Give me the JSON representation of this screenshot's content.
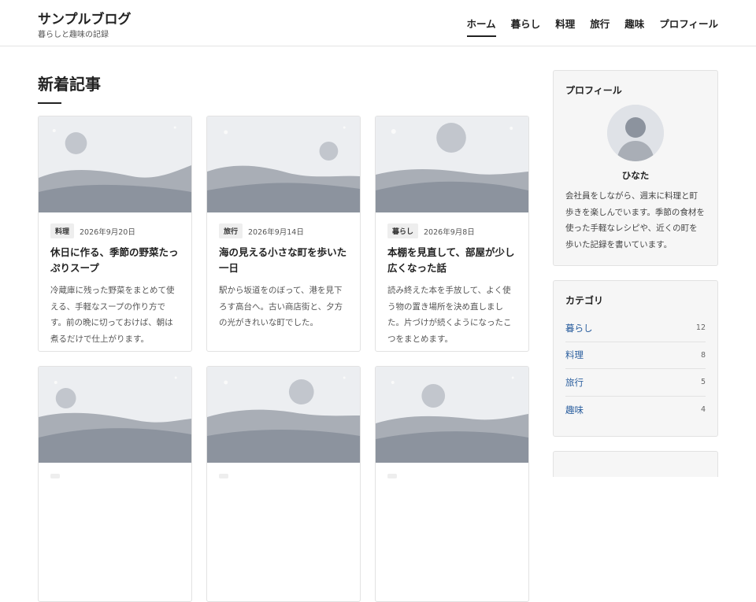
{
  "header": {
    "site_title": "サンプルブログ",
    "tagline": "暮らしと趣味の記録",
    "nav": [
      {
        "label": "ホーム",
        "active": true
      },
      {
        "label": "暮らし"
      },
      {
        "label": "料理"
      },
      {
        "label": "旅行"
      },
      {
        "label": "趣味"
      },
      {
        "label": "プロフィール"
      }
    ]
  },
  "main": {
    "section_title": "新着記事",
    "posts": [
      {
        "category": "料理",
        "date": "2026年9月20日",
        "title": "休日に作る、季節の野菜たっぷりスープ",
        "excerpt": "冷蔵庫に残った野菜をまとめて使える、手軽なスープの作り方です。前の晩に切っておけば、朝は煮るだけで仕上がります。"
      },
      {
        "category": "旅行",
        "date": "2026年9月14日",
        "title": "海の見える小さな町を歩いた一日",
        "excerpt": "駅から坂道をのぼって、港を見下ろす高台へ。古い商店街と、夕方の光がきれいな町でした。"
      },
      {
        "category": "暮らし",
        "date": "2026年9月8日",
        "title": "本棚を見直して、部屋が少し広くなった話",
        "excerpt": "読み終えた本を手放して、よく使う物の置き場所を決め直しました。片づけが続くようになったこつをまとめます。"
      },
      {
        "category": "",
        "date": "",
        "title": "",
        "excerpt": ""
      },
      {
        "category": "",
        "date": "",
        "title": "",
        "excerpt": ""
      },
      {
        "category": "",
        "date": "",
        "title": "",
        "excerpt": ""
      }
    ]
  },
  "sidebar": {
    "profile": {
      "title": "プロフィール",
      "name": "ひなた",
      "bio": "会社員をしながら、週末に料理と町歩きを楽しんでいます。季節の食材を使った手軽なレシピや、近くの町を歩いた記録を書いています。"
    },
    "categories": {
      "title": "カテゴリ",
      "items": [
        {
          "label": "暮らし",
          "count": "12"
        },
        {
          "label": "料理",
          "count": "8"
        },
        {
          "label": "旅行",
          "count": "5"
        },
        {
          "label": "趣味",
          "count": "4"
        }
      ]
    }
  },
  "colors": {
    "accent_link": "#2a5e9e",
    "thumb_sky": "#eceef1",
    "thumb_hill_back": "#a9aeb6",
    "thumb_hill_front": "#8c939e",
    "thumb_sun": "#c2c6cd"
  }
}
